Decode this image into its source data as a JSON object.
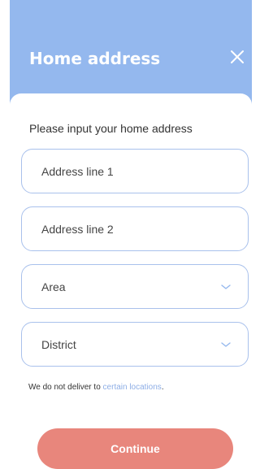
{
  "header": {
    "title": "Home address",
    "close_icon": "close-icon",
    "background": "#94b8ee"
  },
  "form": {
    "prompt": "Please input your home address",
    "address_line_1": {
      "placeholder": "Address line 1",
      "value": ""
    },
    "address_line_2": {
      "placeholder": "Address line 2",
      "value": ""
    },
    "area": {
      "label": "Area",
      "icon": "chevron-down-icon"
    },
    "district": {
      "label": "District",
      "icon": "chevron-down-icon"
    },
    "note_prefix": "We do not deliver to ",
    "note_link": "certain locations",
    "note_suffix": "."
  },
  "actions": {
    "continue_label": "Continue",
    "continue_color": "#e8867c"
  },
  "colors": {
    "accent": "#94b8ee",
    "field_border": "#a9c1ec",
    "link": "#8eaee6"
  }
}
